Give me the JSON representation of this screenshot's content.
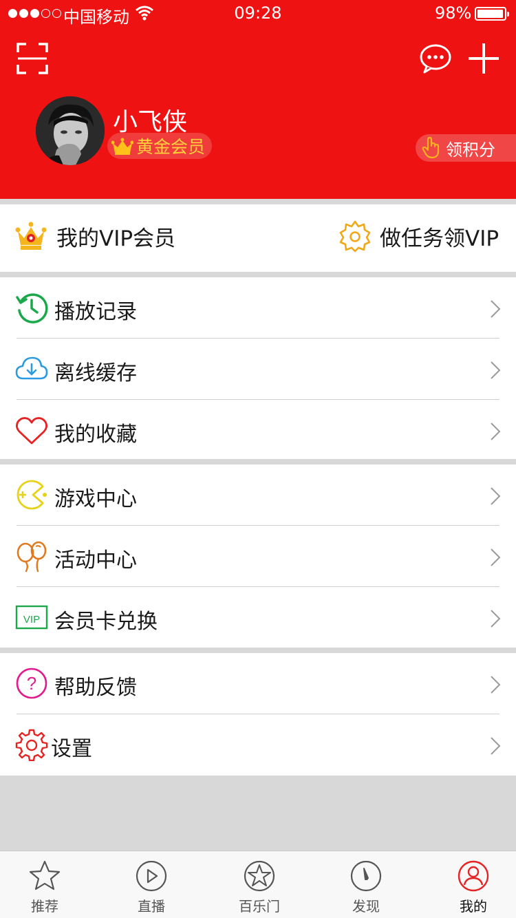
{
  "status_bar": {
    "carrier": "中国移动",
    "time": "09:28",
    "battery": "98%"
  },
  "profile": {
    "username": "小飞侠",
    "member_level": "黄金会员",
    "points_label": "领积分"
  },
  "vip": {
    "my_vip": "我的VIP会员",
    "task_vip": "做任务领VIP"
  },
  "menu": {
    "history": "播放记录",
    "offline": "离线缓存",
    "favorites": "我的收藏",
    "games": "游戏中心",
    "events": "活动中心",
    "card_redeem": "会员卡兑换",
    "help": "帮助反馈",
    "settings": "设置"
  },
  "tabs": {
    "recommend": "推荐",
    "live": "直播",
    "baile": "百乐门",
    "discover": "发现",
    "mine": "我的"
  },
  "colors": {
    "brand_red": "#ee1212",
    "gold": "#ffd23c",
    "green": "#1aa84a",
    "blue": "#2a9be0",
    "orange": "#e07a1f",
    "pink": "#e21b8c"
  }
}
